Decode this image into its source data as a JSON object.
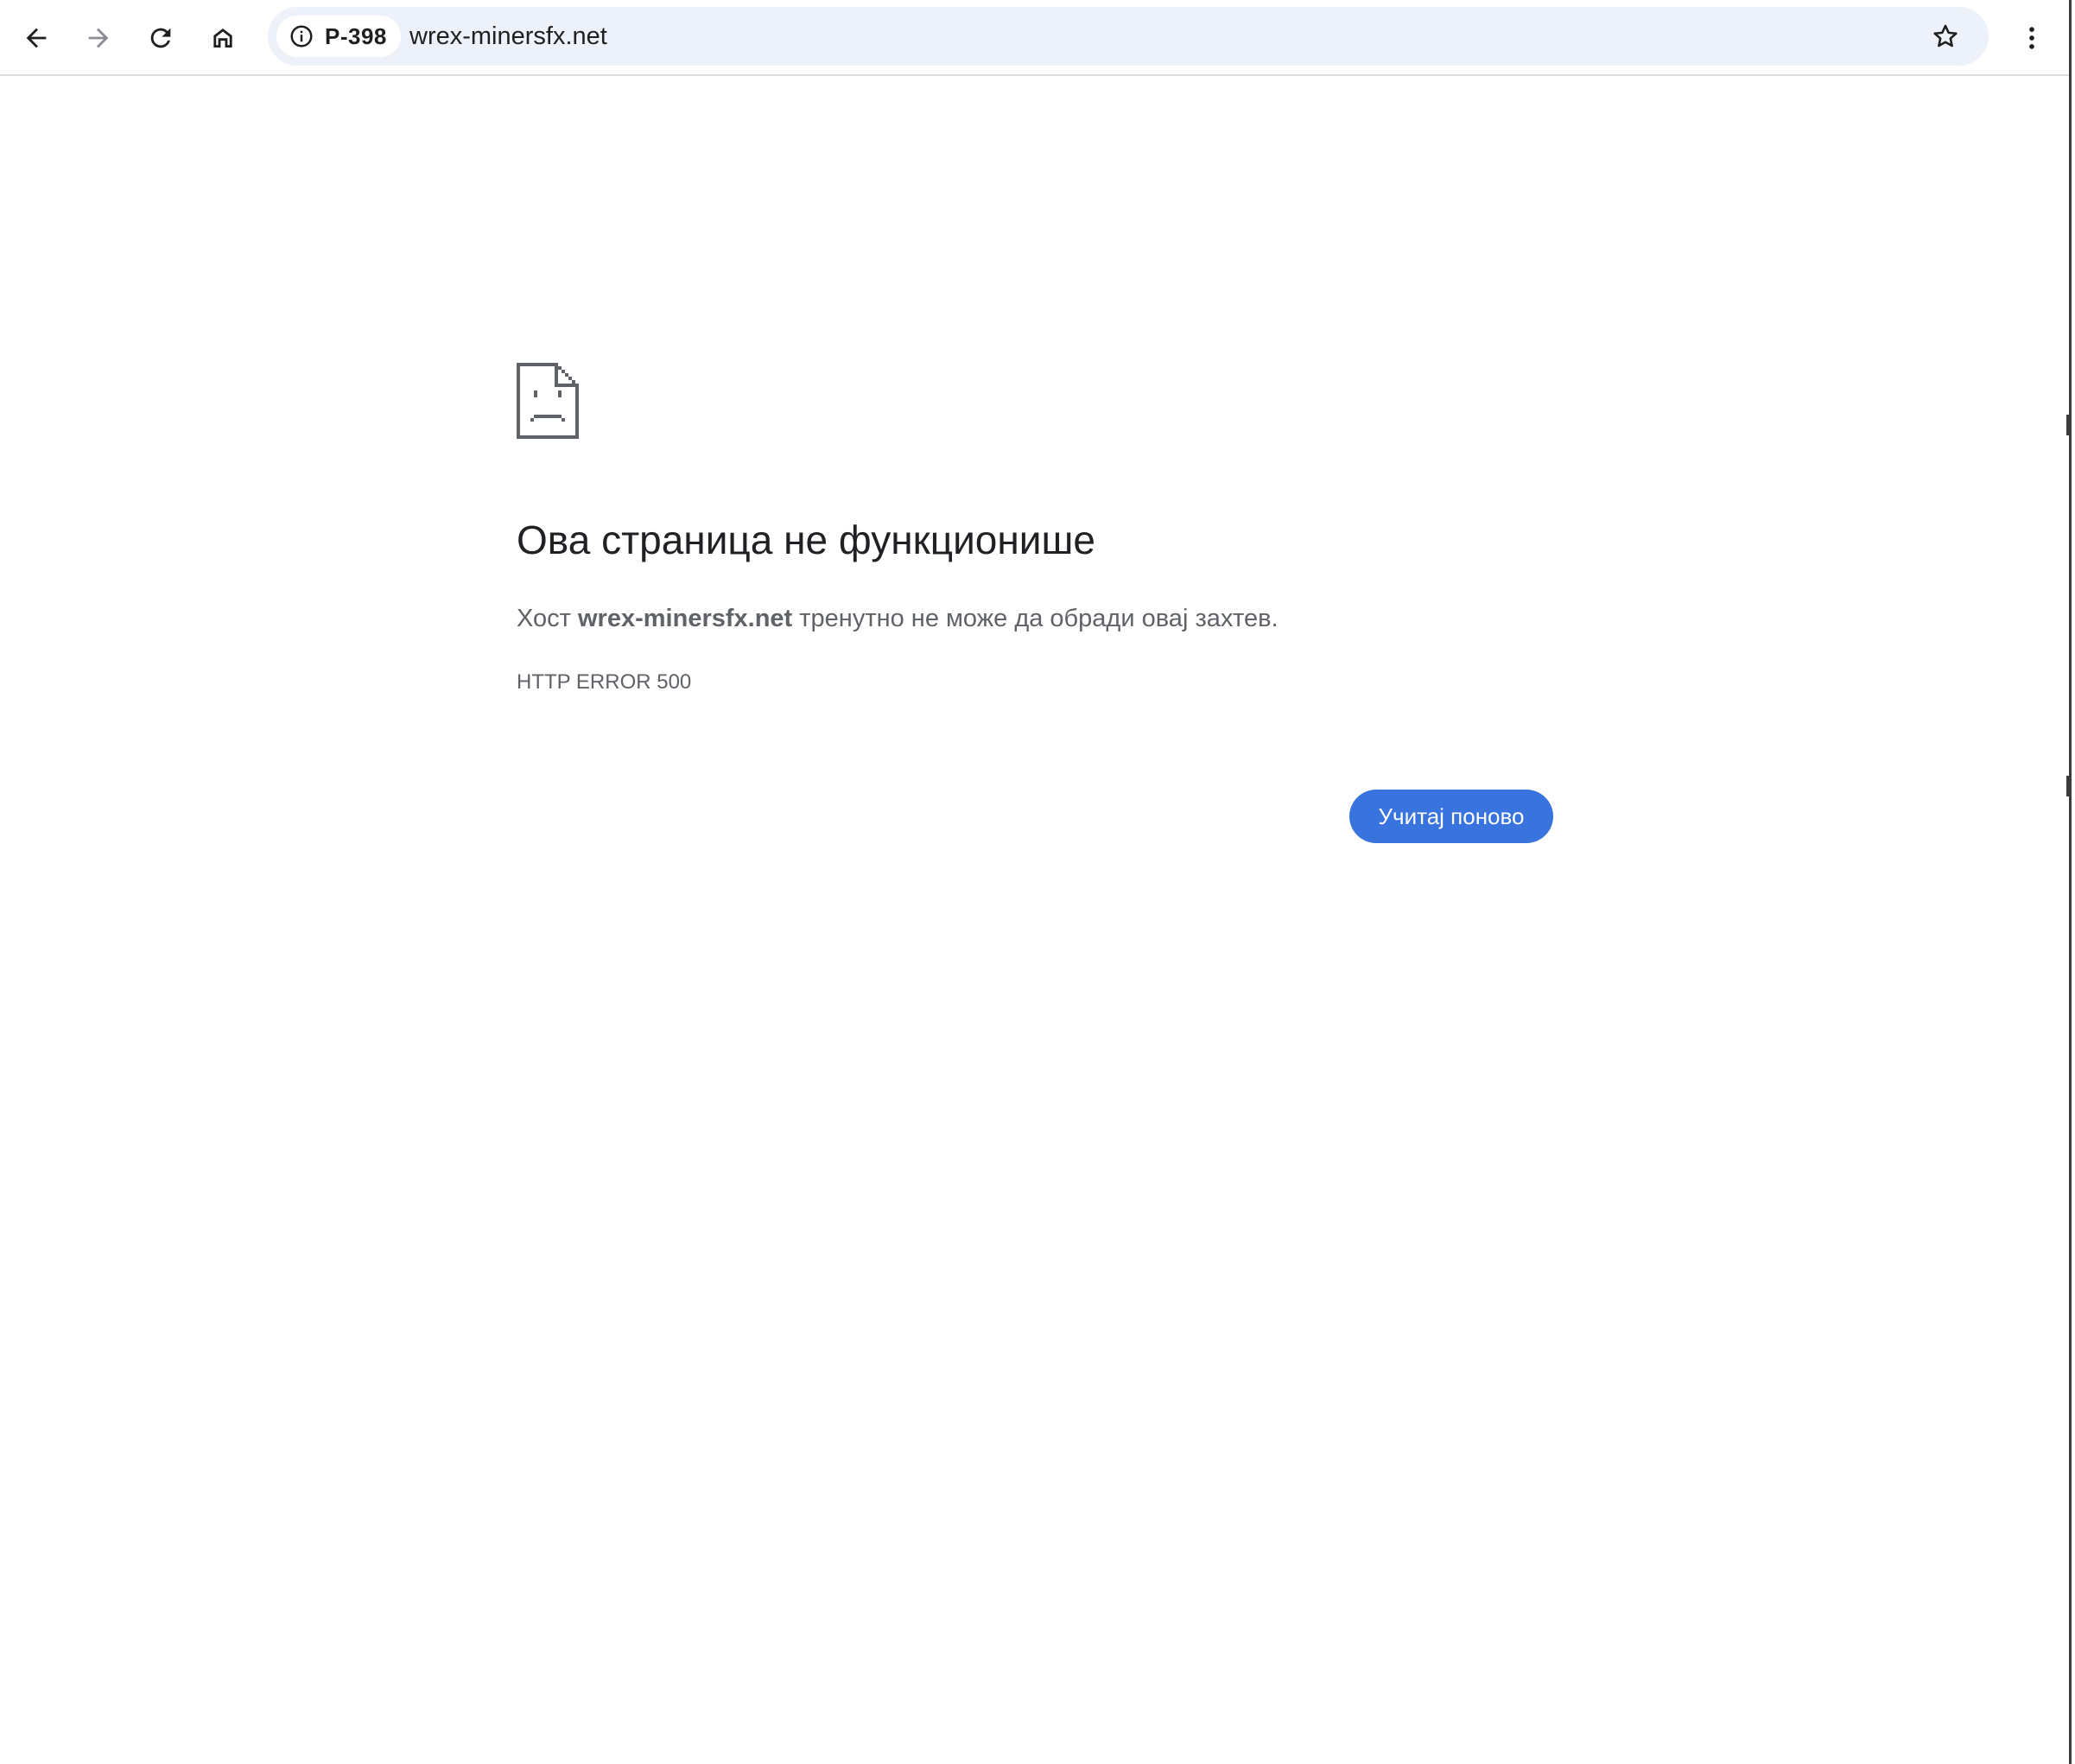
{
  "browser": {
    "security_chip_label": "P-398",
    "url": "wrex-minersfx.net",
    "icons": {
      "back": "arrow-left-icon",
      "forward": "arrow-right-icon",
      "reload": "reload-icon",
      "home": "home-icon",
      "info": "info-icon",
      "bookmark": "star-icon",
      "menu": "kebab-menu-icon"
    }
  },
  "error": {
    "icon": "sad-page-icon",
    "title": "Ова страница не функционише",
    "desc_prefix": "Хост ",
    "desc_host": "wrex-minersfx.net",
    "desc_suffix": " тренутно не може да обради овај захтев.",
    "code": "HTTP ERROR 500",
    "reload_label": "Учитај поново"
  },
  "colors": {
    "accent": "#3873de",
    "omnibox_bg": "#edf2fa",
    "title_text": "#202124",
    "secondary_text": "#5f6368"
  }
}
